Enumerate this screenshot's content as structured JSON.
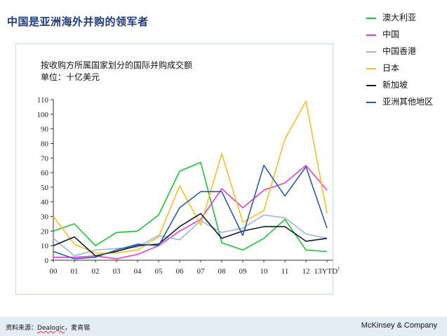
{
  "slide": {
    "title": "中国是亚洲海外并购的领军者"
  },
  "chart_title": {
    "line1": "按收购方所属国家划分的国际并购成交额",
    "line2": "单位：十亿美元"
  },
  "legend": [
    {
      "name": "澳大利亚",
      "color": "#1fc23a"
    },
    {
      "name": "中国",
      "color": "#e83ecf"
    },
    {
      "name": "中国香港",
      "color": "#9db6d8"
    },
    {
      "name": "日本",
      "color": "#f5c02a"
    },
    {
      "name": "新加坡",
      "color": "#101836"
    },
    {
      "name": "亚洲其他地区",
      "color": "#2a5aa8"
    }
  ],
  "chart_data": {
    "type": "line",
    "x": [
      "00",
      "01",
      "02",
      "03",
      "04",
      "05",
      "06",
      "07",
      "08",
      "09",
      "10",
      "11",
      "12",
      "13YTD"
    ],
    "x_footnote": "1",
    "ylim": [
      0,
      110
    ],
    "yticks": [
      0,
      10,
      20,
      30,
      40,
      50,
      60,
      70,
      80,
      90,
      100,
      110
    ],
    "grid": false,
    "legend_position": "right",
    "series": [
      {
        "name": "澳大利亚",
        "color": "#1fc23a",
        "values": [
          20,
          25,
          10,
          19,
          20,
          31,
          61,
          67,
          12,
          7,
          15,
          28,
          7,
          6
        ]
      },
      {
        "name": "中国",
        "color": "#e83ecf",
        "values": [
          2,
          2,
          3,
          1,
          4,
          10,
          20,
          28,
          49,
          36,
          48,
          53,
          65,
          48
        ]
      },
      {
        "name": "中国香港",
        "color": "#9db6d8",
        "values": [
          15,
          3,
          7,
          8,
          9,
          17,
          14,
          27,
          19,
          22,
          31,
          29,
          18,
          15
        ]
      },
      {
        "name": "日本",
        "color": "#f5c02a",
        "values": [
          30,
          11,
          5,
          5,
          7,
          16,
          51,
          24,
          73,
          26,
          34,
          83,
          109,
          32
        ]
      },
      {
        "name": "新加坡",
        "color": "#101836",
        "values": [
          10,
          16,
          3,
          6,
          10,
          11,
          23,
          32,
          15,
          20,
          23,
          23,
          13,
          15
        ]
      },
      {
        "name": "亚洲其他地区",
        "color": "#2a5aa8",
        "values": [
          6,
          1,
          2,
          7,
          11,
          10,
          36,
          47,
          47,
          17,
          65,
          44,
          64,
          22
        ]
      }
    ]
  },
  "footer": {
    "source_prefix": "资料来源：",
    "source_name": "Dealogic",
    "source_suffix": "，麦肯锡",
    "brand": "McKinsey & Company"
  }
}
